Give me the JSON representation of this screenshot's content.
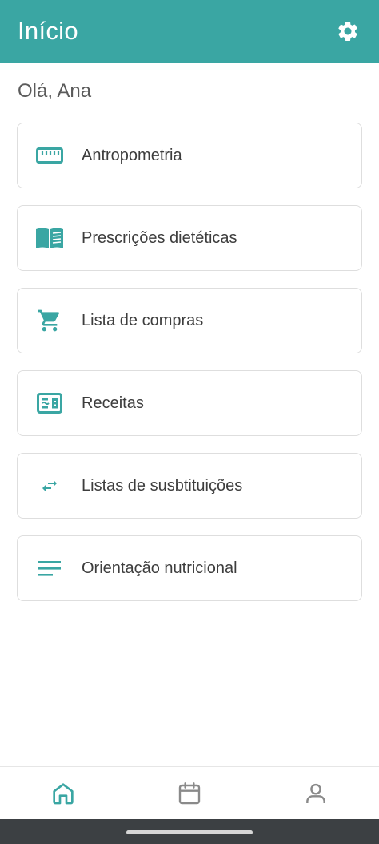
{
  "header": {
    "title": "Início",
    "settings_icon": "gear-icon"
  },
  "greeting": "Olá, Ana",
  "theme": {
    "accent": "#3aa6a3",
    "nav_inactive": "#8a8a8a"
  },
  "menu": {
    "items": [
      {
        "label": "Antropometria",
        "icon": "ruler-icon"
      },
      {
        "label": "Prescrições dietéticas",
        "icon": "book-icon"
      },
      {
        "label": "Lista de compras",
        "icon": "shopping-cart-icon"
      },
      {
        "label": "Receitas",
        "icon": "recipe-card-icon"
      },
      {
        "label": "Listas de susbtituições",
        "icon": "swap-arrows-icon"
      },
      {
        "label": "Orientação nutricional",
        "icon": "notes-lines-icon"
      }
    ]
  },
  "bottom_nav": {
    "items": [
      {
        "icon": "home-icon",
        "active": true
      },
      {
        "icon": "calendar-icon",
        "active": false
      },
      {
        "icon": "user-icon",
        "active": false
      }
    ]
  }
}
